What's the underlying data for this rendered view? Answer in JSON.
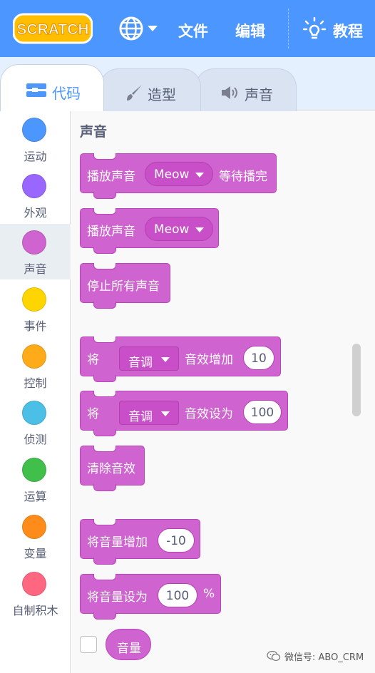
{
  "menubar": {
    "logo_text": "SCRATCH",
    "file_label": "文件",
    "edit_label": "编辑",
    "tutorial_label": "教程",
    "globe_icon": "globe-icon",
    "tutorial_icon": "lightbulb-icon"
  },
  "tabs": [
    {
      "label": "代码",
      "icon": "code-icon",
      "selected": true
    },
    {
      "label": "造型",
      "icon": "paintbrush-icon",
      "selected": false
    },
    {
      "label": "声音",
      "icon": "speaker-icon",
      "selected": false
    }
  ],
  "categories": [
    {
      "label": "运动",
      "color": "#4c97ff"
    },
    {
      "label": "外观",
      "color": "#9966ff"
    },
    {
      "label": "声音",
      "color": "#cf63cf",
      "selected": true
    },
    {
      "label": "事件",
      "color": "#ffd500"
    },
    {
      "label": "控制",
      "color": "#ffab19"
    },
    {
      "label": "侦测",
      "color": "#4cbfe6"
    },
    {
      "label": "运算",
      "color": "#40bf4a"
    },
    {
      "label": "变量",
      "color": "#ff8c1a"
    },
    {
      "label": "自制积木",
      "color": "#ff6680"
    }
  ],
  "palette": {
    "section_title": "声音",
    "blocks": {
      "play_until_done": {
        "prefix": "播放声音",
        "sound": "Meow",
        "suffix": "等待播完"
      },
      "start_sound": {
        "prefix": "播放声音",
        "sound": "Meow"
      },
      "stop_all": {
        "label": "停止所有声音"
      },
      "change_effect": {
        "prefix": "将",
        "effect": "音调",
        "suffix": "音效增加",
        "value": "10"
      },
      "set_effect": {
        "prefix": "将",
        "effect": "音调",
        "suffix": "音效设为",
        "value": "100"
      },
      "clear_effects": {
        "label": "清除音效"
      },
      "change_volume": {
        "prefix": "将音量增加",
        "value": "-10"
      },
      "set_volume": {
        "prefix": "将音量设为",
        "value": "100",
        "suffix": "%"
      },
      "volume_reporter": {
        "label": "音量",
        "checked": false
      }
    }
  },
  "watermark": {
    "text": "微信号: ABO_CRM"
  },
  "colors": {
    "menubar": "#4c97ff",
    "sound_block": "#cf63cf",
    "sound_block_border": "#bd42bd"
  }
}
